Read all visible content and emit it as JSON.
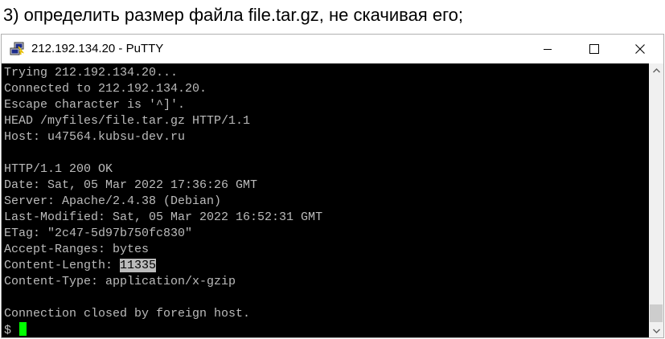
{
  "caption": "3) определить размер файла file.tar.gz, не скачивая его;",
  "window": {
    "title": "212.192.134.20 - PuTTY",
    "icons": {
      "app": "putty-icon",
      "minimize": "minimize-icon",
      "maximize": "maximize-icon",
      "close": "close-icon"
    }
  },
  "terminal": {
    "colors": {
      "background": "#000000",
      "foreground": "#bbbbbb",
      "cursor": "#00ff00",
      "selection": "#bbbbbb"
    },
    "lines": [
      "Trying 212.192.134.20...",
      "Connected to 212.192.134.20.",
      "Escape character is '^]'.",
      "HEAD /myfiles/file.tar.gz HTTP/1.1",
      "Host: u47564.kubsu-dev.ru",
      "",
      "HTTP/1.1 200 OK",
      "Date: Sat, 05 Mar 2022 17:36:26 GMT",
      "Server: Apache/2.4.38 (Debian)",
      "Last-Modified: Sat, 05 Mar 2022 16:52:31 GMT",
      "ETag: \"2c47-5d97b750fc830\"",
      "Accept-Ranges: bytes"
    ],
    "content_length_label": "Content-Length: ",
    "content_length_value": "11335",
    "lines_after": [
      "Content-Type: application/x-gzip",
      "",
      "Connection closed by foreign host."
    ],
    "prompt": "$ "
  },
  "scrollbar": {
    "up_icon": "scroll-up-arrow-icon",
    "down_icon": "scroll-down-arrow-icon"
  }
}
